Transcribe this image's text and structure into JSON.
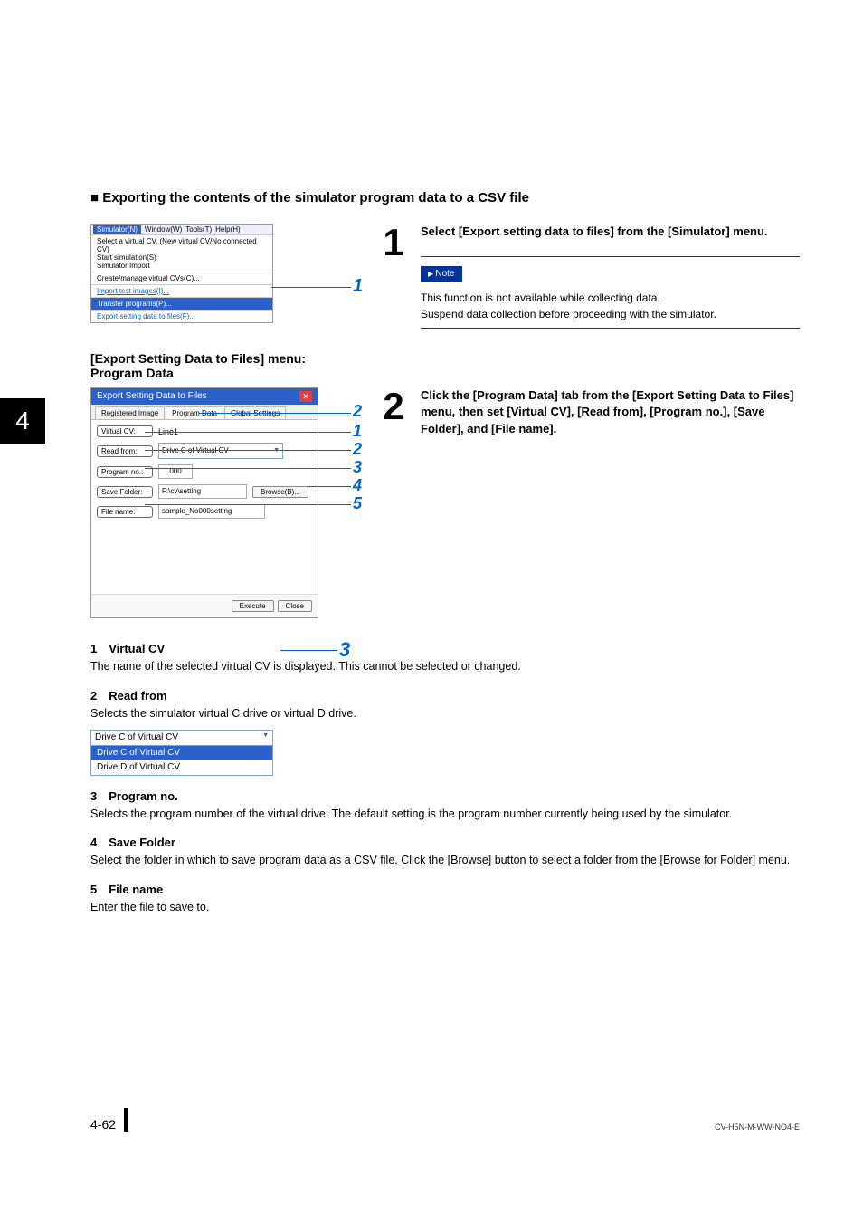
{
  "chapter_tab": "4",
  "section_title": "Exporting the contents of the simulator program data to a CSV file",
  "menushot": {
    "menubar": [
      "Simulator(N)",
      "Window(W)",
      "Tools(T)",
      "Help(H)"
    ],
    "group1_line1": "Select a virtual CV. (New virtual CV/No connected CV)",
    "group1_line2": "Start simulation(S)",
    "group1_line3": "Simulator Import",
    "group2_line1": "Create/manage virtual CVs(C)...",
    "group2_line2": "Import test images(I)...",
    "group2_line3": "Transfer programs(P)...",
    "group2_line4": "Export setting data to files(F)...",
    "callout": "1"
  },
  "step1": {
    "num": "1",
    "text": "Select [Export setting data to files] from the [Simulator] menu.",
    "note_label": "Note",
    "note_line1": "This function is not available while collecting data.",
    "note_line2": "Suspend data collection before proceeding with the simulator."
  },
  "subtitle_lines": {
    "l1": "[Export Setting Data to Files] menu:",
    "l2": "Program Data"
  },
  "dialog": {
    "title": "Export Setting Data to Files",
    "tabs": [
      "Registered Image",
      "Program Data",
      "Global Settings"
    ],
    "vcv_label": "Virtual CV:",
    "vcv_value": "Line1",
    "read_label": "Read from:",
    "read_value": "Drive C of Virtual CV",
    "prog_label": "Program no.:",
    "prog_value": "000",
    "save_label": "Save Folder:",
    "save_value": "F:\\cv\\setting",
    "browse": "Browse(B)...",
    "file_label": "File name:",
    "file_value": "sample_No000setting",
    "execute": "Execute",
    "close": "Close",
    "co2": "2",
    "co1": "1",
    "co_r2": "2",
    "co_r3": "3",
    "co_r4": "4",
    "co_r5": "5",
    "co_big3": "3"
  },
  "step2": {
    "num": "2",
    "text": "Click the [Program Data] tab from the [Export Setting Data to Files] menu, then set [Virtual CV], [Read from], [Program no.], [Save Folder], and [File name]."
  },
  "desc": {
    "h1": "1 Virtual CV",
    "d1": "The name of the selected virtual CV is displayed. This cannot be selected or changed.",
    "h2": "2 Read from",
    "d2": "Selects the simulator virtual C drive or virtual D drive.",
    "dropdown_head": "Drive C of Virtual CV",
    "dropdown_o1": "Drive C of Virtual CV",
    "dropdown_o2": "Drive D of Virtual CV",
    "h3": "3 Program no.",
    "d3": "Selects the program number of the virtual drive. The default setting is the program number currently being used by the simulator.",
    "h4": "4 Save Folder",
    "d4": "Select the folder in which to save program data as a CSV file. Click the [Browse] button to select a folder from the [Browse for Folder] menu.",
    "h5": "5 File name",
    "d5": "Enter the file to save to."
  },
  "footer": {
    "page": "4-62",
    "doc": "CV-H5N-M-WW-NO4-E"
  }
}
